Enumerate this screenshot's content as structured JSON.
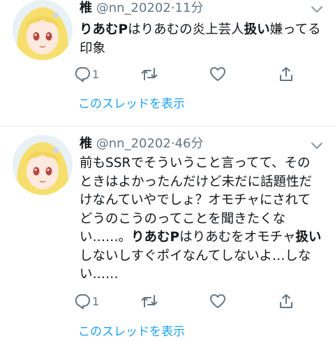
{
  "tweets": [
    {
      "name": "椎",
      "handle": "@nn_20202",
      "dot": "·",
      "time": "11分",
      "body_parts": [
        {
          "text": "りあむP",
          "bold": true
        },
        {
          "text": "はりあむの炎上芸人",
          "bold": false
        },
        {
          "text": "扱い",
          "bold": true
        },
        {
          "text": "嫌ってる印象",
          "bold": false
        }
      ],
      "reply_count": "1",
      "show_thread": "このスレッドを表示"
    },
    {
      "name": "椎",
      "handle": "@nn_20202",
      "dot": "·",
      "time": "46分",
      "body_parts": [
        {
          "text": "前もSSRでそういうこと言ってて、そのときはよかったんだけど未だに話題性だけなんていやでしょ？オモチャにされてどうのこうのってことを聞きたくない……。",
          "bold": false
        },
        {
          "text": "りあむP",
          "bold": true
        },
        {
          "text": "はりあむをオモチャ",
          "bold": false
        },
        {
          "text": "扱い",
          "bold": true
        },
        {
          "text": "しないしすぐポイなんてしないよ…しない……",
          "bold": false
        }
      ],
      "reply_count": "1",
      "show_thread": "このスレッドを表示"
    }
  ],
  "icons": {
    "reply": "reply-icon",
    "retweet": "retweet-icon",
    "like": "heart-icon",
    "share": "share-icon",
    "more": "chevron-down-icon"
  },
  "colors": {
    "link": "#1da1f2",
    "muted": "#657786",
    "divider": "#e1e8ed",
    "text": "#14171a"
  }
}
